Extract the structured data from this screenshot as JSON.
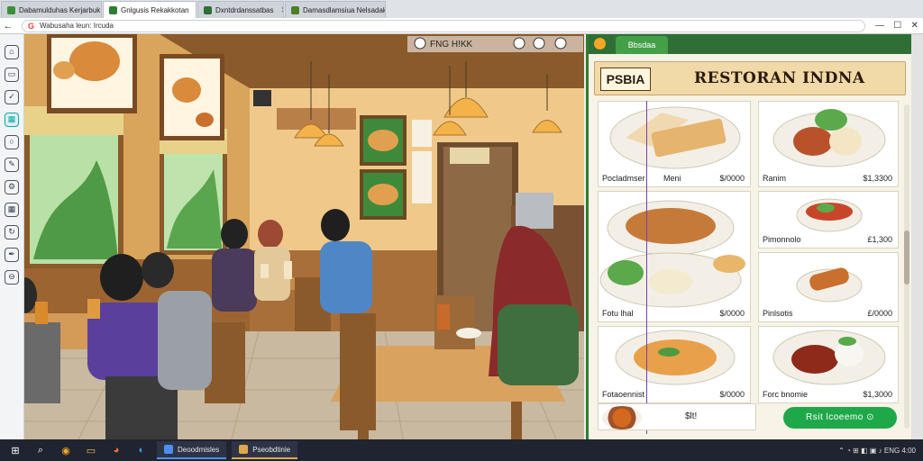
{
  "browser": {
    "tabs": [
      {
        "label": "Dabamulduhas Kerjarbuk bu",
        "favicon_color": "#3a8f3a",
        "active": false
      },
      {
        "label": "Gnlgusis Rekakkotan",
        "favicon_color": "#2e7d32",
        "active": true
      },
      {
        "label": "Dxntdrdanssatbas",
        "favicon_color": "#2e6f36",
        "active": false
      },
      {
        "label": "Damasdlamsiua Nelsadak",
        "favicon_color": "#4e7d28",
        "active": false
      }
    ],
    "address": "Wabusaha leun: Ircuda",
    "back_icon": "arrow-left-icon",
    "window_controls": [
      "—",
      "☐",
      "✕"
    ]
  },
  "sidebar": {
    "icons": [
      {
        "name": "home-icon",
        "glyph": "⌂"
      },
      {
        "name": "monitor-icon",
        "glyph": "▭"
      },
      {
        "name": "check-icon",
        "glyph": "✓"
      },
      {
        "name": "app-icon",
        "glyph": "▦",
        "active": true
      },
      {
        "name": "chat-icon",
        "glyph": "○"
      },
      {
        "name": "tool-icon",
        "glyph": "✎"
      },
      {
        "name": "settings-icon",
        "glyph": "⚙"
      },
      {
        "name": "grid-icon",
        "glyph": "▦"
      },
      {
        "name": "refresh-icon",
        "glyph": "↻"
      },
      {
        "name": "pen-icon",
        "glyph": "✒"
      },
      {
        "name": "info-icon",
        "glyph": "⊖"
      }
    ]
  },
  "scene": {
    "toolbar_text": "FNG H!KK"
  },
  "panel": {
    "tab_label": "Bbsdaa",
    "menu_code": "PSBIA",
    "menu_title": "RESTORAN INDNA",
    "items": [
      {
        "name": "Pocladmser",
        "mid": "Meni",
        "price": "$/0000"
      },
      {
        "name": "Ranim",
        "mid": "",
        "price": "$1,3300"
      },
      {
        "name": "",
        "mid": "",
        "price": "$/0000"
      },
      {
        "name": "Pimonnolo",
        "mid": "",
        "price": "£1,300"
      },
      {
        "name": "Fotu lhal",
        "mid": "",
        "price": "£/0000"
      },
      {
        "name": "Pinlsotis",
        "mid": "",
        "price": "£1,3000"
      },
      {
        "name": "Fotaoennist",
        "mid": "",
        "price": "$/0000"
      },
      {
        "name": "Forc bnomie",
        "mid": "",
        "price": "$1,3000"
      }
    ],
    "bottom_label": "$lt!",
    "order_button": "Rsit lcoeemo ⊙"
  },
  "taskbar": {
    "apps": [
      {
        "label": "Deoodmisles",
        "color": "#4f8ef7"
      },
      {
        "label": "Pseobdtinie",
        "color": "#e0a84a"
      }
    ],
    "tray": "⌃  ◔  ⊞  ◧  ▣  ♪  ENG  4:00"
  }
}
